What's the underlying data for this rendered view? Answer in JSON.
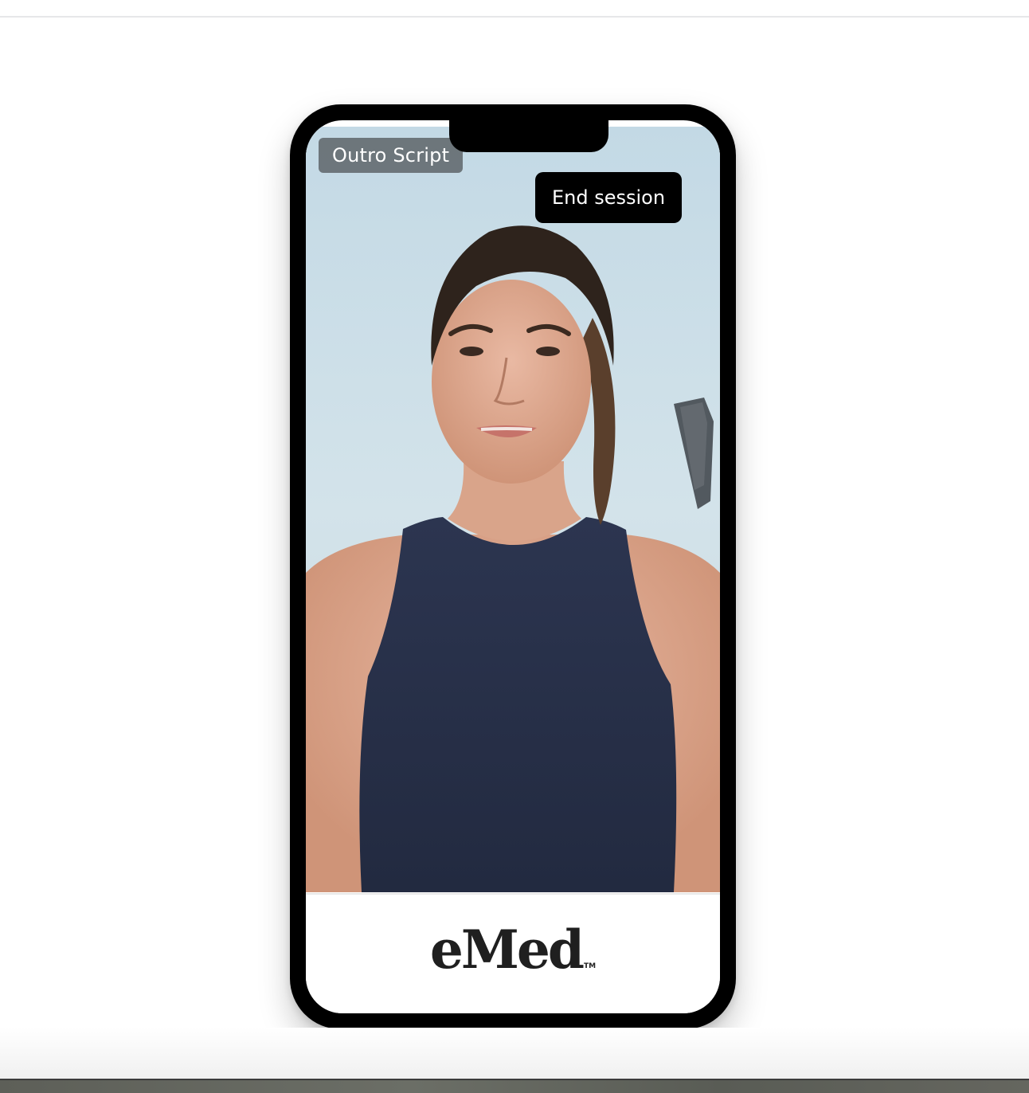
{
  "session": {
    "script_label": "Outro Script",
    "end_button_label": "End session"
  },
  "brand": {
    "logo_text": "eMed",
    "trademark": "TM"
  },
  "video": {
    "description_icon": "presenter-video"
  },
  "colors": {
    "phone_frame": "#000000",
    "button_bg": "#000000",
    "button_text": "#ffffff",
    "badge_bg": "#555a5e",
    "logo_text": "#1f1f1f"
  }
}
